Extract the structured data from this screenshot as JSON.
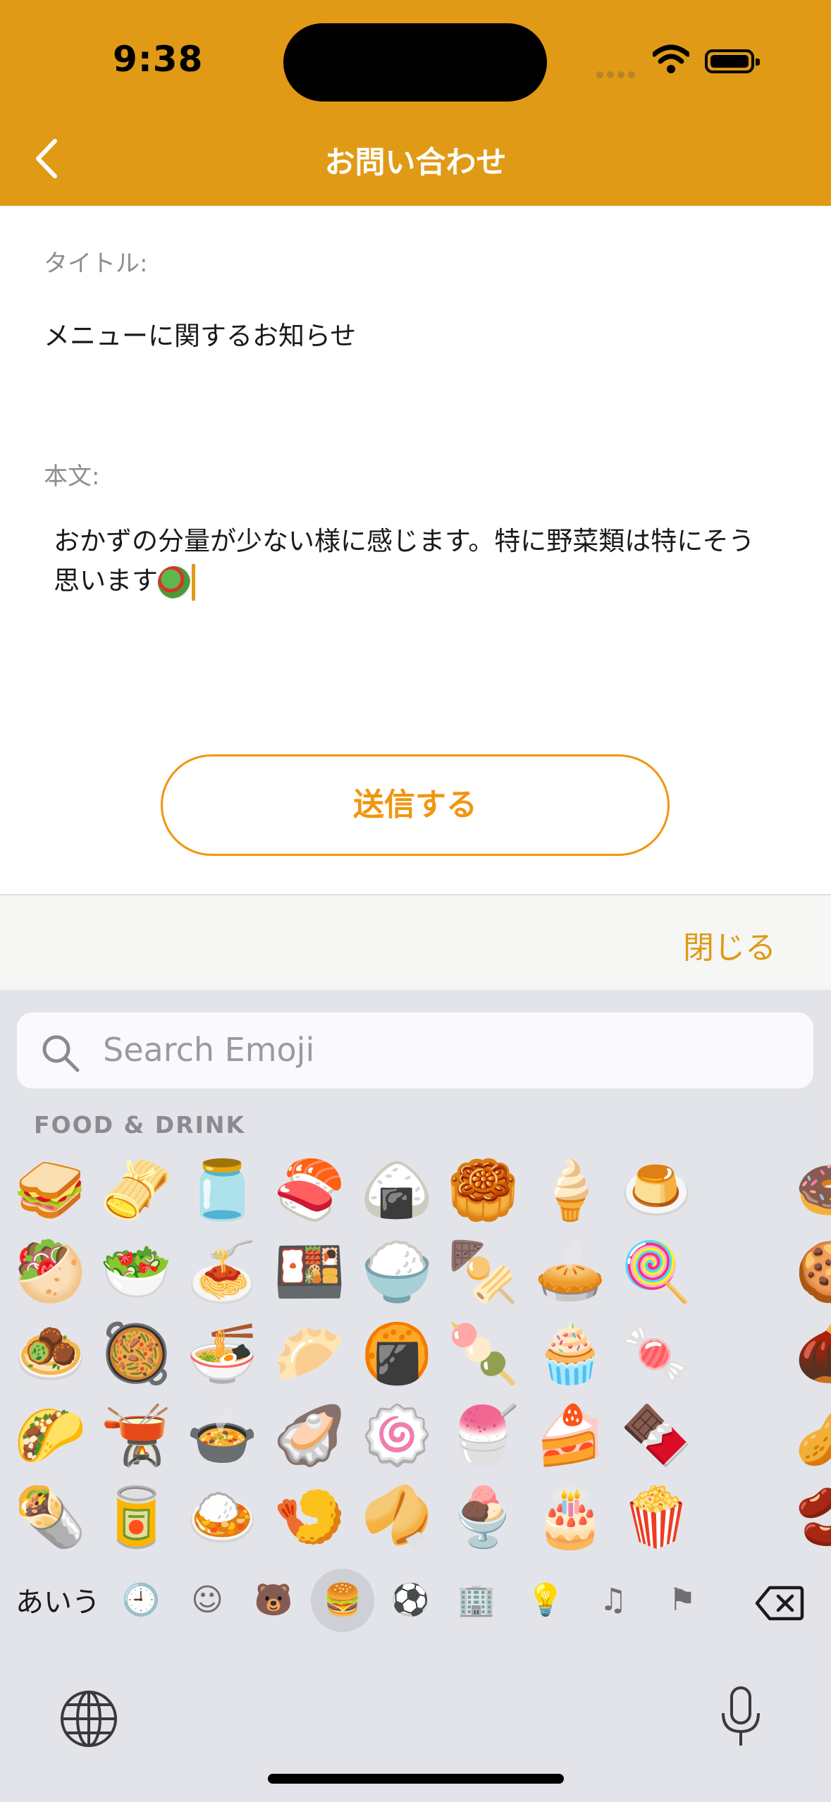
{
  "status": {
    "time": "9:38"
  },
  "nav": {
    "title": "お問い合わせ",
    "back_icon": "chevron-left-icon"
  },
  "form": {
    "title_label": "タイトル:",
    "title_value": "メニューに関するお知らせ",
    "body_label": "本文:",
    "body_value": "おかずの分量が少ない様に感じます。特に野菜類は特にそう思います",
    "submit_label": "送信する"
  },
  "toolbar": {
    "close_label": "閉じる"
  },
  "keyboard": {
    "search_placeholder": "Search Emoji",
    "section_title": "FOOD & DRINK",
    "lang_key": "あいう",
    "emoji_rows": [
      [
        "🥪",
        "🫔",
        "🫙",
        "🍣",
        "🍙",
        "🥮",
        "🍦",
        "🍮",
        "🍩"
      ],
      [
        "🥙",
        "🥗",
        "🍝",
        "🍱",
        "🍚",
        "🍢",
        "🥧",
        "🍭",
        "🍪"
      ],
      [
        "🧆",
        "🥘",
        "🍜",
        "🥟",
        "🍘",
        "🍡",
        "🧁",
        "🍬",
        "🌰"
      ],
      [
        "🌮",
        "🫕",
        "🍲",
        "🦪",
        "🍥",
        "🍧",
        "🍰",
        "🍫",
        "🥜"
      ],
      [
        "🌯",
        "🥫",
        "🍛",
        "🍤",
        "🥠",
        "🍨",
        "🎂",
        "🍿",
        "🫘"
      ]
    ],
    "categories": [
      {
        "name": "recent-icon",
        "glyph": "🕘"
      },
      {
        "name": "smileys-icon",
        "glyph": "☺"
      },
      {
        "name": "animals-icon",
        "glyph": "🐻"
      },
      {
        "name": "food-icon",
        "glyph": "🍔",
        "selected": true
      },
      {
        "name": "activity-icon",
        "glyph": "⚽"
      },
      {
        "name": "travel-icon",
        "glyph": "🏢"
      },
      {
        "name": "objects-icon",
        "glyph": "💡"
      },
      {
        "name": "symbols-icon",
        "glyph": "♫"
      },
      {
        "name": "flags-icon",
        "glyph": "⚑"
      }
    ]
  },
  "colors": {
    "accent": "#E09A15",
    "button": "#F0960F"
  }
}
